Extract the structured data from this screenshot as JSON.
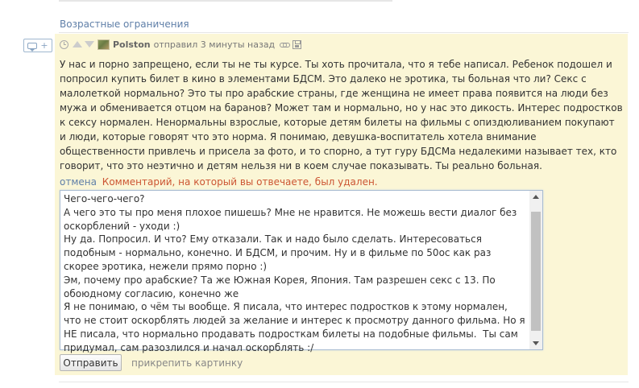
{
  "section": {
    "tag_link": "Возрастные ограничения"
  },
  "reply_button": {
    "icon": "comment-bubble-icon",
    "plus": "+"
  },
  "comment": {
    "author": "Polston",
    "action_time": "отправил 3 минуты назад",
    "body": "У нас и порно запрещено, если ты не ты курсе. Ты хоть прочитала, что я тебе написал. Ребенок подошел и попросил купить билет в кино в элементами БДСМ. Это далеко не эротика, ты больная что ли? Секс с малолеткой нормально? Это ты про арабские страны, где женщина не имеет права появится на люди без мужа и обменивается отцом на баранов? Может там и нормально, но у нас это дикость. Интерес подростков к сексу нормален. Ненормальны взрослые, которые детям билеты на фильмы с опиздюливанием покупают и люди, которые говорят что это норма. Я понимаю, девушка-воспитатель хотела внимание общественности привлечь и присела за фото, и то спорно, а тут гуру БДСМа недалекими называет тех, кто говорит, что это неэтично и детям нельзя ни в коем случае показывать. Ты реально больная.",
    "colors": {
      "background": "#fbf6d6",
      "link": "#5f7fa8",
      "deleted": "#cc5533"
    }
  },
  "reply": {
    "cancel_label": "отмена",
    "deleted_notice": "Комментарий, на который вы отвечаете, был удален.",
    "textarea_value": "Чего-чего-чего?\nА чего это ты про меня плохое пишешь? Мне не нравится. Не можешь вести диалог без оскорблений - уходи :)\nНу да. Попросил. И что? Ему отказали. Так и надо было сделать. Интересоваться подобным - нормально, конечно. И БДСМ, и прочим. Ну и в фильме по 50ос как раз скорее эротика, нежели прямо порно :)\nЭм, почему про арабские? Та же Южная Корея, Япония. Там разрешен секс с 13. По обоюдному согласию, конечно же\nЯ не понимаю, о чём ты вообще. Я писала, что интерес подростков к этому нормален, что не стоит оскорблять людей за желание и интерес к просмотру данного фильма. Но я НЕ писала, что нормально продавать подросткам билеты на подобные фильмы.  Ты сам придумал, сам разозлился и начал оскорблять :/",
    "submit_label": "Отправить",
    "attach_label": "прикрепить картинку"
  }
}
